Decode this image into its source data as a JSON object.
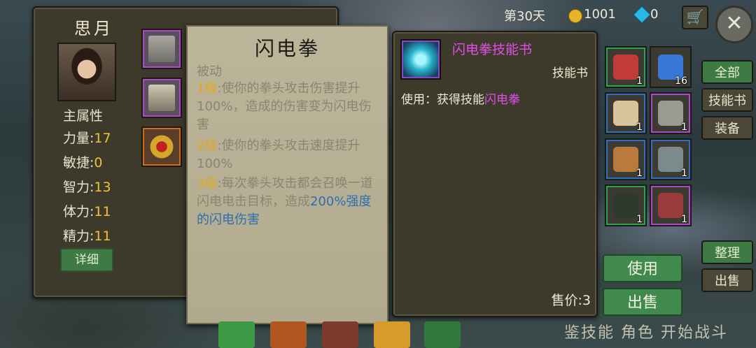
{
  "hud": {
    "day": "第30天",
    "gold": "1001",
    "gems": "0"
  },
  "character": {
    "name": "思月",
    "main_attr_label": "主属性",
    "stats": [
      {
        "label": "力量:",
        "value": "17"
      },
      {
        "label": "敏捷:",
        "value": "0"
      },
      {
        "label": "智力:",
        "value": "13"
      },
      {
        "label": "体力:",
        "value": "11"
      },
      {
        "label": "精力:",
        "value": "11"
      }
    ],
    "detail_button": "详细"
  },
  "skill_tooltip": {
    "title": "闪电拳",
    "type": "被动",
    "lines": [
      {
        "level": "1级",
        "text": ":使你的拳头攻击伤害提升100%，造成的伤害变为闪电伤害"
      },
      {
        "level": "2级",
        "text": ":使你的拳头攻击速度提升100%"
      },
      {
        "level": "3级",
        "text": ":每次拳头攻击都会召唤一道闪电电击目标，造成",
        "highlight": "200%强度的闪电伤害"
      }
    ]
  },
  "item_detail": {
    "name": "闪电拳技能书",
    "type": "技能书",
    "use_prefix": "使用：获得技能",
    "use_skill": "闪电拳",
    "price": "售价:3"
  },
  "inventory": {
    "slots": [
      {
        "name": "red-potion",
        "count": "1",
        "border": "green",
        "color": "#c23b3b"
      },
      {
        "name": "blue-potion",
        "count": "16",
        "border": "none",
        "color": "#3a78d8"
      },
      {
        "name": "scroll",
        "count": "1",
        "border": "blue",
        "color": "#d8c39a"
      },
      {
        "name": "dagger",
        "count": "1",
        "border": "purple",
        "color": "#9b9a92"
      },
      {
        "name": "horn",
        "count": "1",
        "border": "blue",
        "color": "#b87a3d"
      },
      {
        "name": "helmet",
        "count": "1",
        "border": "blue",
        "color": "#7c8a8c"
      },
      {
        "name": "dark-armor",
        "count": "1",
        "border": "green",
        "color": "#2f3a2c"
      },
      {
        "name": "red-armor",
        "count": "1",
        "border": "purple",
        "color": "#9a3b3b"
      }
    ]
  },
  "tabs": {
    "all": "全部",
    "skillbook": "技能书",
    "equip": "装备",
    "sort": "整理",
    "sell_side": "出售"
  },
  "actions": {
    "use": "使用",
    "sell": "出售"
  },
  "bottom_bar": {
    "text": "鉴技能 角色 开始战斗"
  },
  "colors": {
    "level": "#e2a81e",
    "epic": "#e04fe8",
    "button_green": "#3f8a4c"
  }
}
